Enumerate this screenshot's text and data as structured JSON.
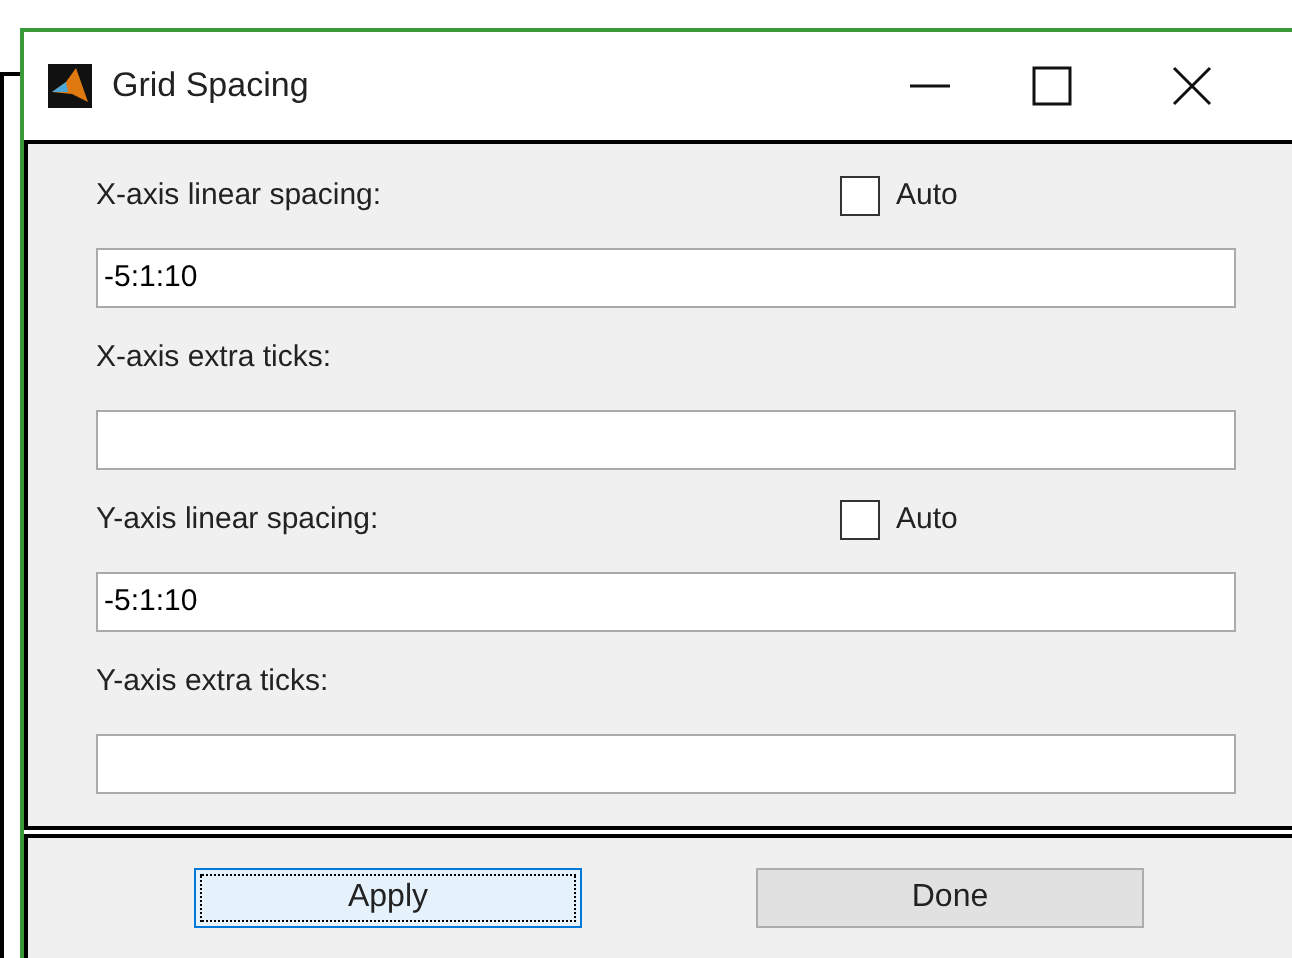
{
  "window": {
    "title": "Grid Spacing"
  },
  "rows": [
    {
      "label": "X-axis linear spacing:",
      "auto": {
        "label": "Auto",
        "checked": false
      },
      "value": "-5:1:10"
    },
    {
      "label": "X-axis extra ticks:"
    },
    {
      "label": "Y-axis linear spacing:",
      "auto": {
        "label": "Auto",
        "checked": false
      },
      "value": "-5:1:10"
    },
    {
      "label": "Y-axis extra ticks:"
    }
  ],
  "buttons": [
    {
      "label": "Apply",
      "focused": true
    },
    {
      "label": "Done",
      "focused": false
    }
  ]
}
